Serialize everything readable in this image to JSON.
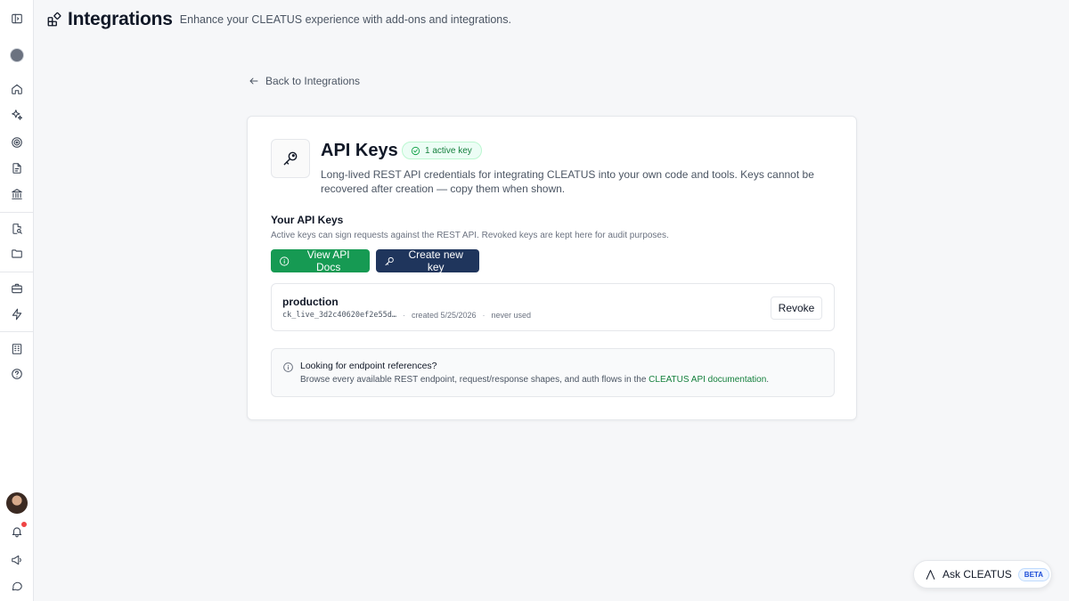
{
  "header": {
    "title": "Integrations",
    "subtitle": "Enhance your CLEATUS experience with add-ons and integrations."
  },
  "nav": {
    "back_label": "Back to Integrations"
  },
  "sidebar": {
    "icons": [
      "panel-toggle-icon",
      "org-avatar",
      "home-icon",
      "sparkles-icon",
      "target-icon",
      "document-icon",
      "bank-icon",
      "file-search-icon",
      "folder-icon",
      "briefcase-icon",
      "lightning-icon",
      "building-icon",
      "help-icon",
      "user-avatar",
      "bell-icon",
      "megaphone-icon",
      "chat-icon"
    ],
    "notification_color": "#ef4444"
  },
  "card": {
    "title": "API Keys",
    "badge": "1 active key",
    "description": "Long-lived REST API credentials for integrating CLEATUS into your own code and tools. Keys cannot be recovered after creation — copy them when shown.",
    "section_title": "Your API Keys",
    "section_desc": "Active keys can sign requests against the REST API. Revoked keys are kept here for audit purposes.",
    "docs_button": "View API Docs",
    "create_button": "Create new key",
    "keys": [
      {
        "name": "production",
        "key_preview": "ck_live_3d2c40620ef2e55d…",
        "created": "created 5/25/2026",
        "last_used": "never used",
        "revoke_label": "Revoke"
      }
    ],
    "info": {
      "title": "Looking for endpoint references?",
      "text_before": "Browse every available REST endpoint, request/response shapes, and auth flows in the ",
      "link": "CLEATUS API documentation",
      "text_after": "."
    }
  },
  "assistant": {
    "label": "Ask CLEATUS",
    "badge": "BETA"
  },
  "colors": {
    "primary_green": "#169a53",
    "navy": "#1f355c",
    "badge_green": "#15803d"
  }
}
